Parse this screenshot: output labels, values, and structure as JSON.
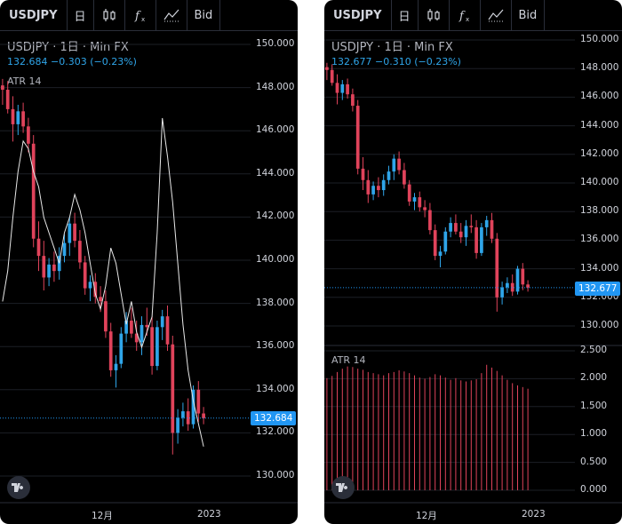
{
  "colors": {
    "up": "#2fa5e9",
    "down": "#e0435b",
    "atr_line": "#e8e8e8",
    "atr_hist": "#e0435b",
    "grid": "#1c1f26",
    "bg": "#000000"
  },
  "left": {
    "toolbar": {
      "symbol": "USDJPY",
      "interval": "日",
      "candle_icon": "candles-icon",
      "fx_icon": "indicator-icon",
      "compare_icon": "compare-icon",
      "bid": "Bid"
    },
    "legend": {
      "title": "USDJPY · 1日 · Min FX",
      "price": "132.684  −0.303 (−0.23%)",
      "atr": "ATR 14"
    },
    "y_axis": [
      "150.000",
      "148.000",
      "146.000",
      "144.000",
      "142.000",
      "140.000",
      "138.000",
      "136.000",
      "134.000",
      "132.000",
      "130.000"
    ],
    "last_price": "132.684",
    "x_axis": [
      "12月",
      "2023"
    ]
  },
  "right": {
    "toolbar": {
      "symbol": "USDJPY",
      "interval": "日",
      "bid": "Bid"
    },
    "legend": {
      "title": "USDJPY · 1日 · Min FX",
      "price": "132.677  −0.310 (−0.23%)",
      "atr": "ATR 14"
    },
    "y_axis": [
      "150.000",
      "148.000",
      "146.000",
      "144.000",
      "142.000",
      "140.000",
      "138.000",
      "136.000",
      "134.000",
      "132.000",
      "130.000"
    ],
    "last_price": "132.677",
    "atr_axis": [
      "2.500",
      "2.000",
      "1.500",
      "1.000",
      "0.500",
      "0.000"
    ],
    "x_axis": [
      "12月",
      "2023"
    ]
  },
  "chart_data": {
    "type": "candlestick",
    "symbol": "USDJPY",
    "ohlc": [
      [
        148.1,
        148.4,
        147.2,
        147.9
      ],
      [
        147.9,
        148.3,
        146.8,
        147.0
      ],
      [
        147.0,
        147.6,
        145.5,
        146.3
      ],
      [
        146.3,
        147.2,
        145.8,
        146.9
      ],
      [
        146.9,
        147.3,
        145.9,
        146.2
      ],
      [
        146.2,
        146.6,
        145.0,
        145.4
      ],
      [
        145.4,
        145.8,
        140.6,
        141.0
      ],
      [
        141.0,
        141.8,
        139.5,
        140.2
      ],
      [
        140.2,
        140.9,
        138.6,
        139.2
      ],
      [
        139.2,
        140.1,
        138.8,
        139.8
      ],
      [
        139.8,
        140.4,
        139.0,
        139.5
      ],
      [
        139.5,
        140.6,
        139.1,
        140.2
      ],
      [
        140.2,
        141.2,
        139.9,
        140.8
      ],
      [
        140.8,
        142.0,
        140.2,
        141.7
      ],
      [
        141.7,
        142.2,
        140.6,
        140.9
      ],
      [
        140.9,
        141.4,
        139.6,
        139.9
      ],
      [
        139.9,
        140.2,
        138.4,
        138.7
      ],
      [
        138.7,
        139.3,
        138.1,
        139.0
      ],
      [
        139.0,
        139.4,
        138.0,
        138.3
      ],
      [
        138.3,
        138.8,
        137.6,
        138.1
      ],
      [
        138.1,
        138.6,
        136.4,
        136.7
      ],
      [
        136.7,
        137.1,
        134.6,
        134.9
      ],
      [
        134.9,
        135.6,
        134.1,
        135.2
      ],
      [
        135.2,
        136.9,
        135.0,
        136.6
      ],
      [
        136.6,
        137.6,
        136.2,
        137.2
      ],
      [
        137.2,
        137.8,
        136.4,
        136.6
      ],
      [
        136.6,
        137.2,
        135.8,
        136.2
      ],
      [
        136.2,
        137.4,
        135.6,
        137.0
      ],
      [
        137.0,
        137.8,
        136.5,
        136.9
      ],
      [
        136.9,
        137.4,
        134.7,
        135.1
      ],
      [
        135.1,
        137.2,
        134.9,
        136.9
      ],
      [
        136.9,
        137.7,
        136.3,
        137.4
      ],
      [
        137.4,
        137.9,
        135.8,
        136.1
      ],
      [
        136.1,
        136.5,
        131.0,
        132.0
      ],
      [
        132.0,
        133.1,
        131.5,
        132.7
      ],
      [
        132.7,
        133.4,
        132.3,
        133.0
      ],
      [
        133.0,
        133.6,
        132.1,
        132.4
      ],
      [
        132.4,
        134.2,
        132.2,
        134.0
      ],
      [
        134.0,
        134.4,
        132.5,
        132.9
      ],
      [
        132.9,
        133.2,
        132.4,
        132.68
      ]
    ],
    "atr": [
      2.01,
      2.05,
      2.12,
      2.18,
      2.22,
      2.21,
      2.18,
      2.16,
      2.12,
      2.1,
      2.08,
      2.06,
      2.1,
      2.12,
      2.15,
      2.13,
      2.1,
      2.06,
      2.02,
      2.0,
      2.03,
      2.08,
      2.06,
      2.02,
      1.98,
      2.01,
      1.97,
      1.95,
      1.97,
      1.99,
      2.1,
      2.25,
      2.2,
      2.14,
      2.06,
      1.98,
      1.92,
      1.88,
      1.85,
      1.82
    ],
    "y_range": [
      129.5,
      150.5
    ],
    "atr_range": [
      0,
      2.5
    ],
    "x_labels": [
      "12月",
      "2023"
    ]
  }
}
